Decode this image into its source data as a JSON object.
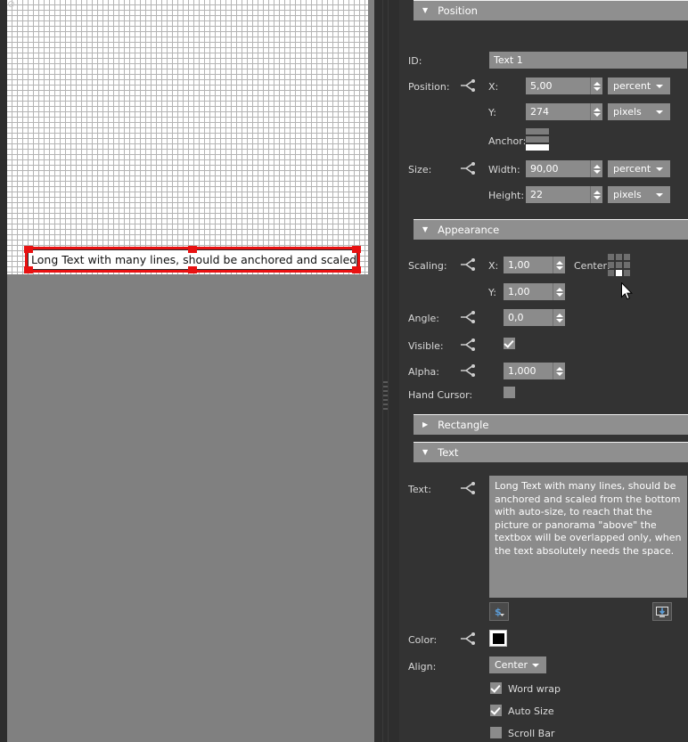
{
  "stage": {
    "selected_object_text": "Long Text with many lines, should be anchored and scaled",
    "selection_color": "#e81111"
  },
  "panel": {
    "sections": {
      "position": {
        "title": "Position",
        "expanded": true,
        "arrow": "▼",
        "fields": {
          "id_label": "ID:",
          "id_value": "Text 1",
          "position_label": "Position:",
          "x_label": "X:",
          "x_value": "5,00",
          "x_unit": "percent",
          "y_label": "Y:",
          "y_value": "274",
          "y_unit": "pixels",
          "anchor_label": "Anchor:",
          "size_label": "Size:",
          "width_label": "Width:",
          "width_value": "90,00",
          "width_unit": "percent",
          "height_label": "Height:",
          "height_value": "22",
          "height_unit": "pixels"
        }
      },
      "appearance": {
        "title": "Appearance",
        "expanded": true,
        "arrow": "▼",
        "fields": {
          "scaling_label": "Scaling:",
          "scale_x_label": "X:",
          "scale_x_value": "1,00",
          "scale_y_label": "Y:",
          "scale_y_value": "1,00",
          "center_label": "Center:",
          "angle_label": "Angle:",
          "angle_value": "0,0",
          "visible_label": "Visible:",
          "visible_checked": true,
          "alpha_label": "Alpha:",
          "alpha_value": "1,000",
          "hand_cursor_label": "Hand Cursor:",
          "hand_cursor_checked": false
        }
      },
      "rectangle": {
        "title": "Rectangle",
        "expanded": false,
        "arrow": "▶"
      },
      "text": {
        "title": "Text",
        "expanded": true,
        "arrow": "▼",
        "fields": {
          "text_label": "Text:",
          "text_value": "Long Text with many lines, should be anchored and scaled from the bottom with auto-size, to reach that the picture or panorama \"above\" the textbox will be overlapped only, when the text absolutely needs the space.",
          "variable_button_icon": "dollar-variable-icon",
          "import_button_icon": "import-screen-icon",
          "color_label": "Color:",
          "color_value": "#000000",
          "align_label": "Align:",
          "align_value": "Center",
          "word_wrap_label": "Word wrap",
          "word_wrap_checked": true,
          "auto_size_label": "Auto Size",
          "auto_size_checked": true,
          "scroll_bar_label": "Scroll Bar",
          "scroll_bar_checked": false
        }
      }
    }
  }
}
